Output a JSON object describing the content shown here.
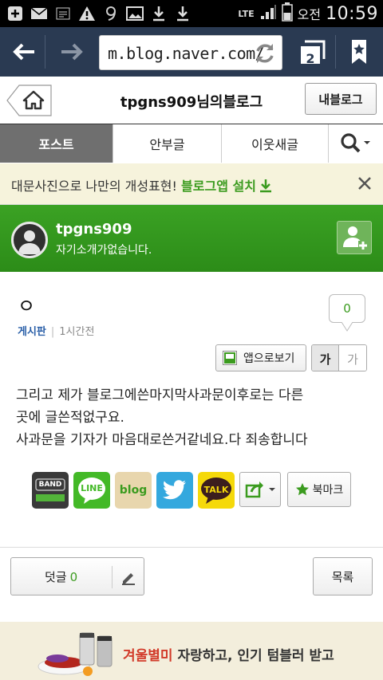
{
  "status_bar": {
    "network": "LTE",
    "ampm": "오전",
    "time": "10:59"
  },
  "browser": {
    "url": "m.blog.naver.com/",
    "tab_count": "2"
  },
  "blog": {
    "title": "tpgns909님의블로그",
    "my_blog_label": "내블로그"
  },
  "tabs": [
    {
      "label": "포스트",
      "active": true
    },
    {
      "label": "안부글",
      "active": false
    },
    {
      "label": "이웃새글",
      "active": false
    }
  ],
  "promo": {
    "text": "대문사진으로 나만의 개성표현!",
    "link": "블로그앱 설치"
  },
  "profile": {
    "name": "tpgns909",
    "description": "자기소개가없습니다."
  },
  "post": {
    "title": "ㅇ",
    "category": "게시판",
    "time": "1시간전",
    "likes": "0",
    "app_view_label": "앱으로보기",
    "font_large": "가",
    "font_small": "가",
    "body": [
      "그리고 제가 블로그에쓴마지막사과문이후로는 다른",
      "곳에 글쓴적없구요.",
      "사과문을 기자가 마음대로쓴거같네요.다 죄송합니다"
    ]
  },
  "share": {
    "band": "BAND",
    "line": "LINE",
    "blog": "blog",
    "talk": "TALK",
    "bookmark_label": "북마크"
  },
  "footer": {
    "comment_label": "덧글",
    "comment_count": "0",
    "list_label": "목록"
  },
  "ad": {
    "highlight": "겨울별미",
    "text": " 자랑하고, 인기 텀블러 받고"
  },
  "colors": {
    "browser_bar": "#2a3a52",
    "profile_green": "#3ba224",
    "accent_green": "#3b9b1f",
    "category_blue": "#2a5fa8",
    "promo_bg": "#f6f3dc"
  }
}
